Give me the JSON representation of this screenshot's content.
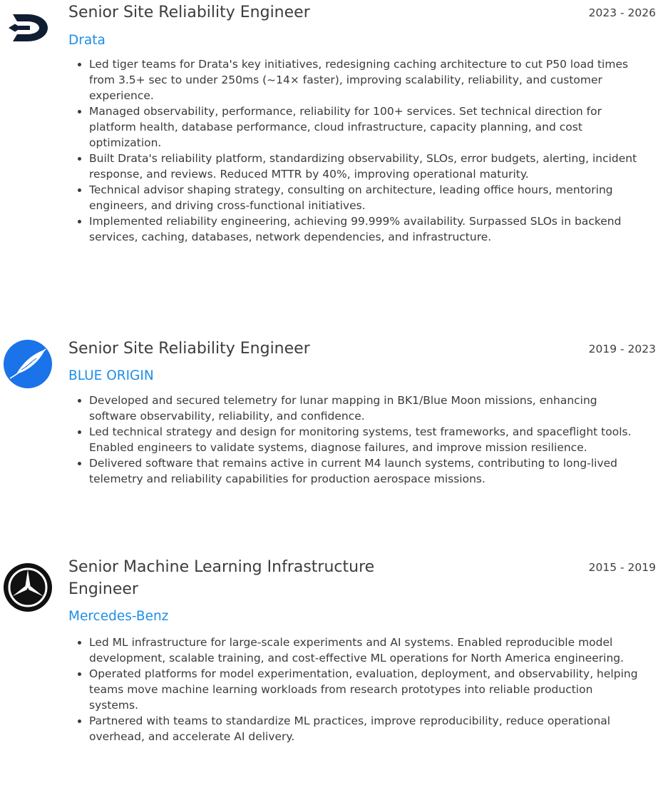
{
  "experience": [
    {
      "title": "Senior Site Reliability Engineer",
      "dates": "2023 - 2026",
      "company": "Drata",
      "logo_icon": "drata-logo-icon",
      "bullets": [
        "Led tiger teams for Drata's key initiatives, redesigning caching architecture to cut P50 load times from 3.5+ sec to under 250ms (~14× faster), improving scalability, reliability, and customer experience.",
        "Managed observability, performance, reliability for 100+ services. Set technical direction for platform health, database performance, cloud infrastructure, capacity planning, and cost optimization.",
        "Built Drata's reliability platform, standardizing observability, SLOs, error budgets, alerting, incident response, and reviews. Reduced MTTR by 40%, improving operational maturity.",
        "Technical advisor shaping strategy, consulting on architecture, leading office hours, mentoring engineers, and driving cross-functional initiatives.",
        "Implemented reliability engineering, achieving 99.999% availability. Surpassed SLOs in backend services, caching, databases, network dependencies, and infrastructure."
      ]
    },
    {
      "title": "Senior Site Reliability Engineer",
      "dates": "2019 - 2023",
      "company": "BLUE ORIGIN",
      "logo_icon": "feather-icon",
      "bullets": [
        "Developed and secured telemetry for lunar mapping in BK1/Blue Moon missions, enhancing software observability, reliability, and confidence.",
        "Led technical strategy and design for monitoring systems, test frameworks, and spaceflight tools. Enabled engineers to validate systems, diagnose failures, and improve mission resilience.",
        "Delivered software that remains active in current M4 launch systems, contributing to long-lived telemetry and reliability capabilities for production aerospace missions."
      ]
    },
    {
      "title": "Senior Machine Learning Infrastructure Engineer",
      "dates": "2015 - 2019",
      "company": "Mercedes-Benz",
      "logo_icon": "three-pointed-star-icon",
      "bullets": [
        "Led ML infrastructure for large-scale experiments and AI systems. Enabled reproducible model development, scalable training, and cost-effective ML operations for North America engineering.",
        "Operated platforms for model experimentation, evaluation, deployment, and observability, helping teams move machine learning workloads from research prototypes into reliable production systems.",
        "Partnered with teams to standardize ML practices, improve reproducibility, reduce operational overhead, and accelerate AI delivery."
      ]
    }
  ],
  "colors": {
    "link": "#1e8ee6",
    "text": "#3a3a3a",
    "drata_logo": "#0f1e33",
    "blue_origin_logo": "#1a73e8",
    "mercedes_logo": "#111111"
  }
}
